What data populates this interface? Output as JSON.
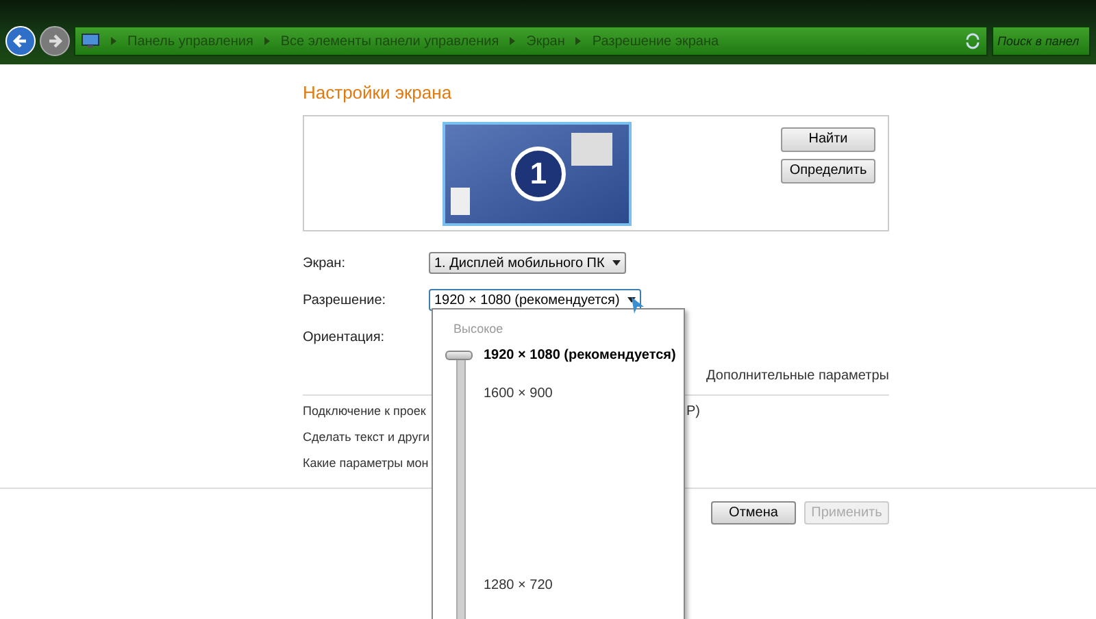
{
  "address_bar": {
    "breadcrumbs": [
      "Панель управления",
      "Все элементы панели управления",
      "Экран",
      "Разрешение экрана"
    ],
    "search_placeholder": "Поиск в панел"
  },
  "title": "Настройки экрана",
  "preview": {
    "monitor_number": "1",
    "buttons": [
      {
        "label": "Найти"
      },
      {
        "label": "Определить"
      }
    ]
  },
  "fields": [
    {
      "label": "Экран:",
      "value": "1. Дисплей мобильного ПК",
      "expanded": false
    },
    {
      "label": "Разрешение:",
      "value": "1920 × 1080 (рекомендуется)",
      "expanded": true
    },
    {
      "label": "Ориентация:"
    }
  ],
  "advanced_link": "Дополнительные параметры",
  "links": [
    {
      "text": "Подключение к проек",
      "tail": "P)"
    },
    {
      "text": "Сделать текст и други"
    },
    {
      "text": "Какие параметры мон"
    }
  ],
  "buttons": [
    {
      "label": "Отмена",
      "disabled": false
    },
    {
      "label": "Применить",
      "disabled": true
    }
  ],
  "resolution_popup": {
    "header": "Высокое",
    "level": 1,
    "options": [
      {
        "label": "1920 × 1080 (рекомендуется)",
        "selected": true
      },
      {
        "label": "1600 × 900",
        "selected": false
      },
      {
        "label": "1280 × 720",
        "selected": false
      }
    ]
  }
}
